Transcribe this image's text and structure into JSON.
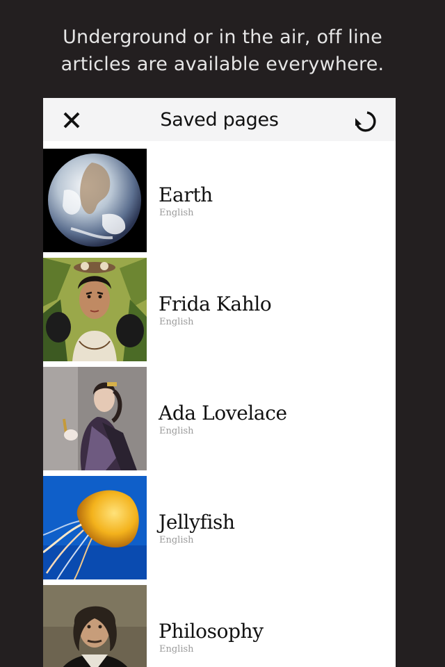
{
  "tagline": {
    "line1": "Underground or in the air, off line",
    "line2": "articles are available everywhere."
  },
  "navbar": {
    "title": "Saved pages",
    "close_icon": "close-icon",
    "refresh_icon": "refresh-icon"
  },
  "pages": [
    {
      "title": "Earth",
      "language": "English",
      "thumbnail": "earth-photo"
    },
    {
      "title": "Frida Kahlo",
      "language": "English",
      "thumbnail": "frida-kahlo-portrait"
    },
    {
      "title": "Ada Lovelace",
      "language": "English",
      "thumbnail": "ada-lovelace-portrait"
    },
    {
      "title": "Jellyfish",
      "language": "English",
      "thumbnail": "jellyfish-photo"
    },
    {
      "title": "Philosophy",
      "language": "English",
      "thumbnail": "philosophy-portrait"
    }
  ],
  "colors": {
    "background": "#231f20",
    "navbar": "#f4f4f5",
    "language_text": "#9a9a9a"
  }
}
